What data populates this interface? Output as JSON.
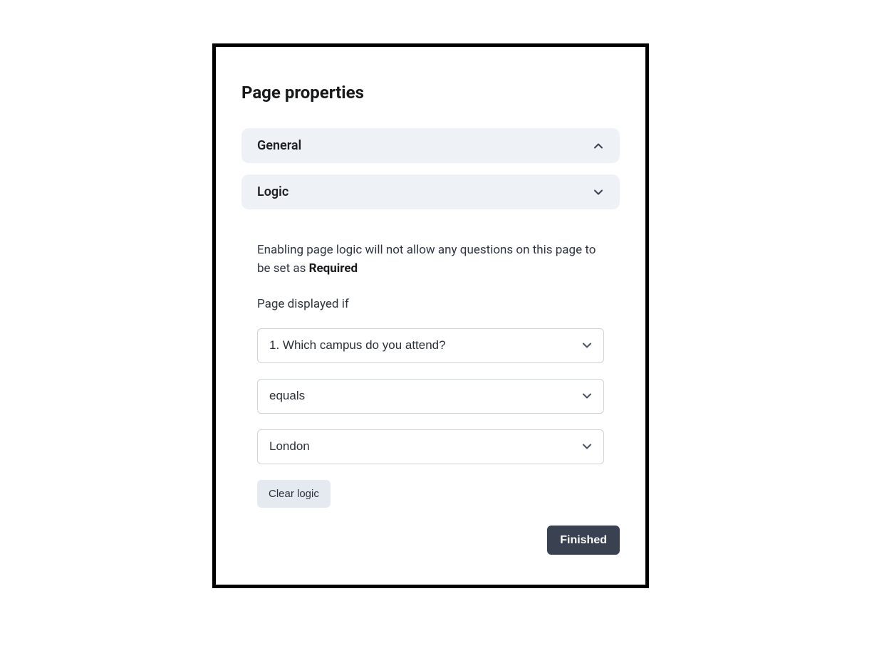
{
  "panel": {
    "title": "Page properties",
    "sections": {
      "general": {
        "label": "General"
      },
      "logic": {
        "label": "Logic",
        "info_prefix": "Enabling page logic will not allow any questions on this page to be set as ",
        "info_bold": "Required",
        "condition_label": "Page displayed if",
        "question_select": "1. Which campus do you attend?",
        "operator_select": "equals",
        "value_select": "London",
        "clear_label": "Clear logic"
      }
    },
    "finished_label": "Finished"
  }
}
